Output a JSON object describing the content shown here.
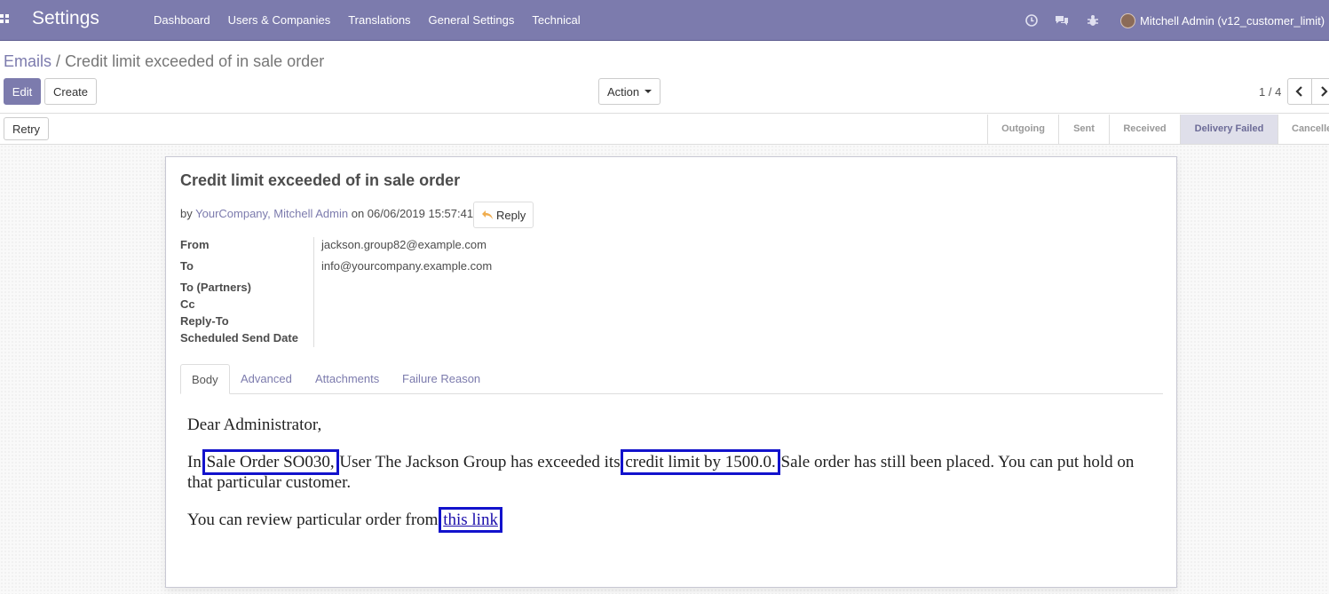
{
  "navbar": {
    "brand": "Settings",
    "menu": [
      "Dashboard",
      "Users & Companies",
      "Translations",
      "General Settings",
      "Technical"
    ],
    "icons": [
      "clock-icon",
      "chat-icon",
      "bug-icon"
    ],
    "user": "Mitchell Admin (v12_customer_limit)",
    "color": "#7c7bad"
  },
  "control_panel": {
    "breadcrumb_parent": "Emails",
    "breadcrumb_sep": "/",
    "breadcrumb_current": "Credit limit exceeded of in sale order",
    "edit_label": "Edit",
    "create_label": "Create",
    "action_label": "Action",
    "pager": "1 / 4"
  },
  "statusbar": {
    "retry_label": "Retry",
    "stages": [
      "Outgoing",
      "Sent",
      "Received",
      "Delivery Failed",
      "Cancelled"
    ],
    "active_stage": "Delivery Failed"
  },
  "mail": {
    "title": "Credit limit exceeded of in sale order",
    "by_prefix": "by",
    "authors": "YourCompany, Mitchell Admin",
    "on_text": "on 06/06/2019 15:57:41",
    "reply_label": "Reply",
    "fields": {
      "from_label": "From",
      "from_value": "jackson.group82@example.com",
      "to_label": "To",
      "to_value": "info@yourcompany.example.com",
      "to_partners_label": "To (Partners)",
      "cc_label": "Cc",
      "reply_to_label": "Reply-To",
      "scheduled_label": "Scheduled Send Date"
    },
    "tabs": [
      "Body",
      "Advanced",
      "Attachments",
      "Failure Reason"
    ],
    "active_tab": "Body",
    "body": {
      "greeting": "Dear Administrator,",
      "p1_prefix": "In",
      "p1_order": "Sale Order SO030,",
      "p1_middle": "User The Jackson Group has exceeded its",
      "p1_limit": "credit limit by 1500.0.",
      "p1_suffix": "Sale order has still been placed. You can put hold on that particular customer.",
      "p2_prefix": "You can review particular order from",
      "p2_link": "this link"
    }
  }
}
